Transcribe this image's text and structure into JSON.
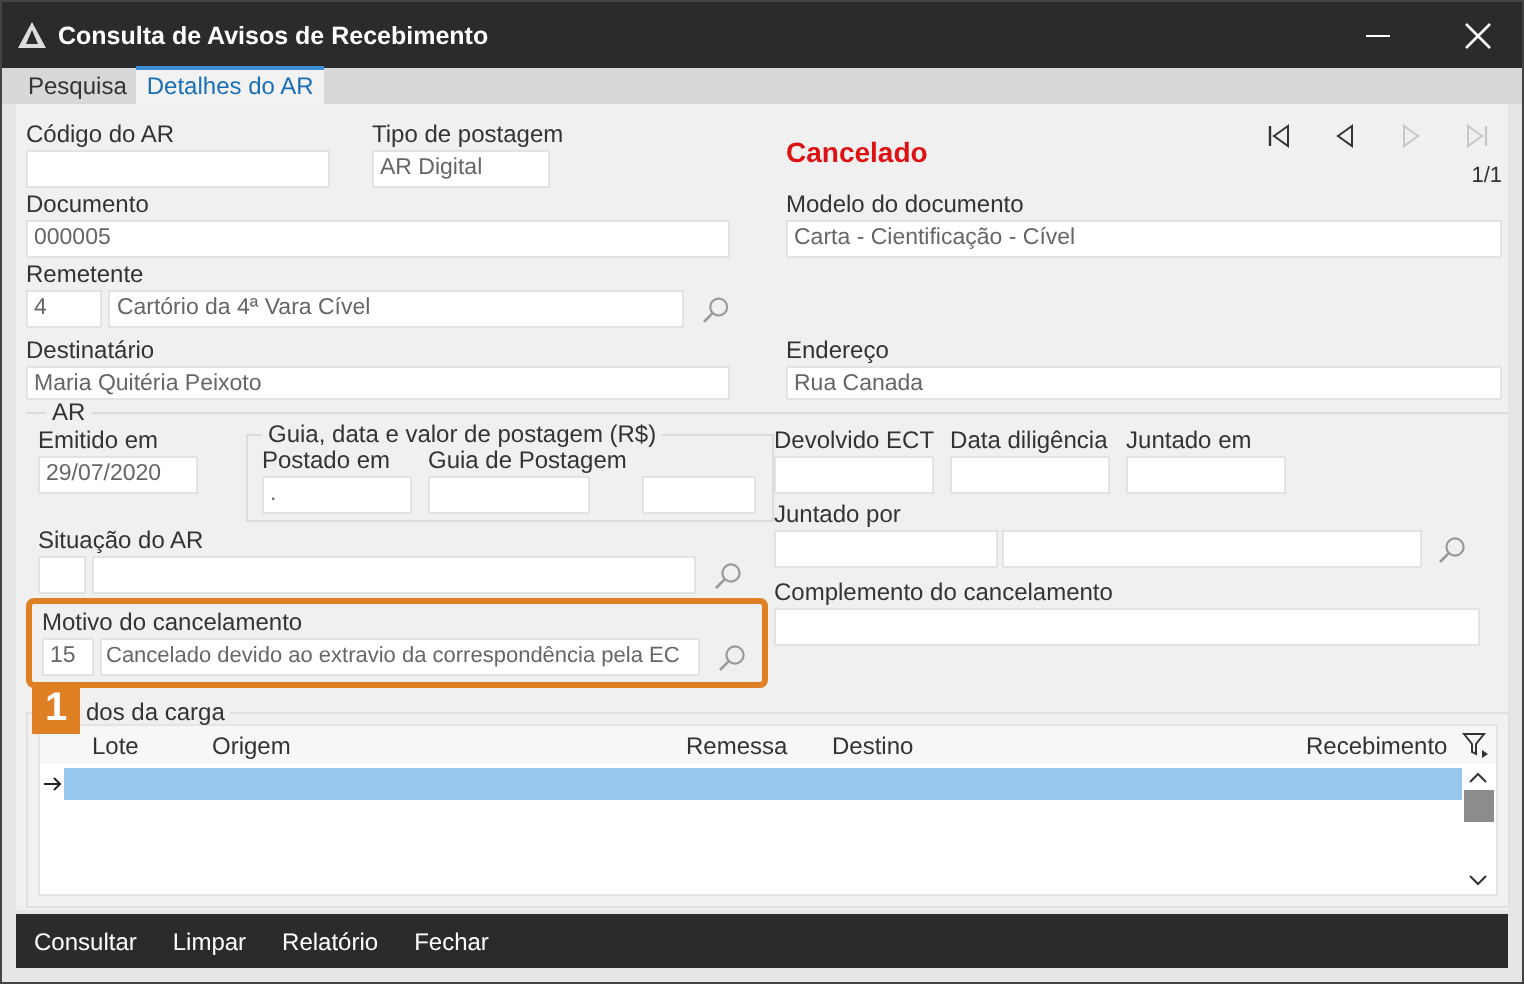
{
  "window": {
    "title": "Consulta de Avisos de Recebimento"
  },
  "tabs": [
    {
      "label": "Pesquisa",
      "selected": false
    },
    {
      "label": "Detalhes do AR",
      "selected": true
    }
  ],
  "status": "Cancelado",
  "navigation": {
    "buttons": [
      {
        "kind": "first",
        "disabled": false
      },
      {
        "kind": "prev",
        "disabled": false
      },
      {
        "kind": "next",
        "disabled": true
      },
      {
        "kind": "last",
        "disabled": true
      }
    ],
    "position": "1/1"
  },
  "codigo_ar": {
    "label": "Código do AR"
  },
  "tipo_postagem": {
    "label": "Tipo de postagem",
    "value": "AR Digital"
  },
  "documento": {
    "label": "Documento",
    "value": "000005"
  },
  "modelo_documento": {
    "label": "Modelo do documento",
    "value": "Carta - Cientificação - Cível"
  },
  "remetente": {
    "label": "Remetente",
    "code": "4",
    "name": "Cartório da 4ª Vara Cível"
  },
  "destinatario": {
    "label": "Destinatário",
    "value": "Maria Quitéria Peixoto"
  },
  "endereco": {
    "label": "Endereço",
    "value": "Rua Canada"
  },
  "ar_group": {
    "legend": "AR",
    "emitido_em": {
      "label": "Emitido em",
      "value": "29/07/2020"
    },
    "postagem": {
      "legend": "Guia, data e valor de postagem (R$)",
      "postado_em": {
        "label": "Postado em",
        "value": "."
      },
      "guia": {
        "label": "Guia de Postagem"
      }
    },
    "situacao": {
      "label": "Situação do AR"
    },
    "motivo": {
      "label": "Motivo do cancelamento",
      "code": "15",
      "name": "Cancelado devido ao extravio da correspondência pela EC",
      "highlighted": true
    },
    "devolvido_ect": {
      "label": "Devolvido ECT"
    },
    "data_diligencia": {
      "label": "Data diligência"
    },
    "juntado_em": {
      "label": "Juntado em"
    },
    "juntado_por": {
      "label": "Juntado por"
    },
    "complemento": {
      "label": "Complemento do cancelamento"
    }
  },
  "callout": {
    "number": "1"
  },
  "carga": {
    "legend": "dos da carga",
    "columns": [
      "Lote",
      "Origem",
      "Remessa",
      "Destino",
      "Recebimento"
    ],
    "rows": [
      {
        "selected": true
      }
    ]
  },
  "buttons": [
    "Consultar",
    "Limpar",
    "Relatório",
    "Fechar"
  ]
}
